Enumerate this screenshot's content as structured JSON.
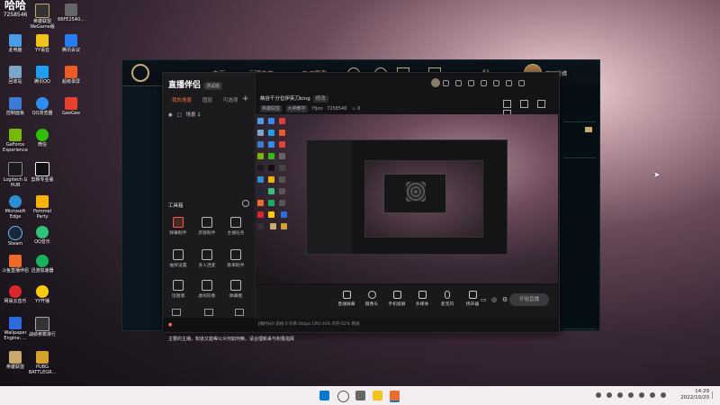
{
  "desktop": {
    "counter_top": "哈哈",
    "counter_num": "7258546",
    "icons": [
      {
        "label": "此电脑",
        "color": "#4b9be6"
      },
      {
        "label": "网易",
        "color": "#e23b3b"
      },
      {
        "label": "回收站",
        "color": "#7aa6c9"
      },
      {
        "label": "控制面板",
        "color": "#3c7bd4"
      },
      {
        "label": "GeForce Experience",
        "color": "#76b900"
      },
      {
        "label": "Logitech G HUB",
        "color": "#1a1a1a"
      },
      {
        "label": "Microsoft Edge",
        "color": "#2c8fd6"
      },
      {
        "label": "Steam",
        "color": "#1b2838"
      },
      {
        "label": "斗鱼直播伴侣",
        "color": "#f06a2a"
      },
      {
        "label": "网易云音乐",
        "color": "#e0262b"
      },
      {
        "label": "Wallpaper Engine: ...",
        "color": "#2b6de0"
      },
      {
        "label": "英雄联盟",
        "color": "#c8aa6e"
      },
      {
        "label": "英雄联盟WeGame版",
        "color": "#333"
      },
      {
        "label": "YY语音",
        "color": "#f2c418"
      },
      {
        "label": "腾讯QQ",
        "color": "#1ea0f0"
      },
      {
        "label": "QQ浏览器",
        "color": "#2e8ef0"
      },
      {
        "label": "微信",
        "color": "#2dc100"
      },
      {
        "label": "剪映专业版",
        "color": "#111"
      },
      {
        "label": "Pommel Party",
        "color": "#f4b400"
      },
      {
        "label": "QQ音乐",
        "color": "#31c27c"
      },
      {
        "label": "迅游加速器",
        "color": "#18b15e"
      },
      {
        "label": "YY开播",
        "color": "#ffcc00"
      },
      {
        "label": "战绩参数排行",
        "color": "#333"
      },
      {
        "label": "PUBG BATTLEGR...",
        "color": "#d4a12a"
      },
      {
        "label": "86FE2540...",
        "color": "#666"
      },
      {
        "label": "腾讯会议",
        "color": "#2a7cf6"
      },
      {
        "label": "超级录屏",
        "color": "#ee5a24"
      },
      {
        "label": "GeeGee",
        "color": "#e7412f"
      },
      {
        "label": "网易UU",
        "color": "#2ebd86"
      }
    ]
  },
  "lol": {
    "tabs": [
      "主页",
      "云顶之弈",
      "PVP赛事"
    ],
    "level": "83",
    "username": "不知所措"
  },
  "app": {
    "name": "直播伴侣",
    "version_badge": "测试版",
    "tabs": [
      "我的场景",
      "图层",
      "可选项"
    ],
    "scene_label": "场景 1",
    "tools_title": "工具箱",
    "tools": [
      {
        "label": "弹幕助手",
        "hot": true
      },
      {
        "label": "房管助手",
        "hot": false
      },
      {
        "label": "主播任务",
        "hot": false
      },
      {
        "label": "抽奖设置",
        "hot": false
      },
      {
        "label": "多人连麦",
        "hot": false
      },
      {
        "label": "歌单助手",
        "hot": false
      },
      {
        "label": "话题墙",
        "hot": false
      },
      {
        "label": "虚拟形象",
        "hot": false
      },
      {
        "label": "弹幕框",
        "hot": false
      }
    ],
    "stream_title": "峡谷千分位伊芙刀king",
    "title_tag": "修改",
    "category": "英雄联盟",
    "subcategory": "大神教学",
    "fans_label": "Yfjoo",
    "room_id": "7258546",
    "online_count": "0",
    "bottom_tools": [
      "直播屏幕",
      "摄像头",
      "手机投屏",
      "多媒体",
      "麦克风",
      "扬声器"
    ],
    "start_live": "开始直播",
    "notice": "主要的主播，知道又能等公众何如何嘛，请合理新来与积极指挥",
    "status": "直播时长0  丢帧:0  码率:0kbps  CPU:34%  内存:62%  网速"
  },
  "taskbar": {
    "time": "14:29",
    "date": "2022/10/20"
  }
}
